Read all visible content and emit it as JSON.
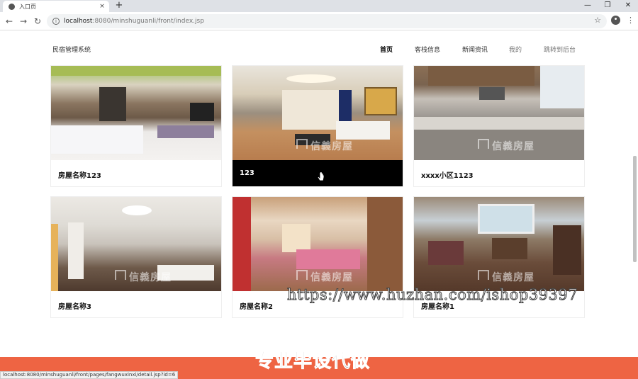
{
  "browser": {
    "tab_title": "入口页",
    "tab_close": "×",
    "new_tab": "+",
    "url_host": "localhost",
    "url_rest": ":8080/minshuguanli/front/index.jsp",
    "back": "←",
    "forward": "→",
    "reload": "↻",
    "info": "i",
    "star": "☆",
    "menu": "⋮",
    "minimize": "—",
    "restore": "❐",
    "close": "✕"
  },
  "header": {
    "site_title": "民宿管理系统",
    "nav": [
      {
        "label": "首页",
        "active": true
      },
      {
        "label": "客栈信息"
      },
      {
        "label": "新闻资讯"
      },
      {
        "label": "我的"
      },
      {
        "label": "跳转到后台"
      }
    ]
  },
  "cards": [
    {
      "title": "房屋名称123",
      "photo": "bedroom-photo"
    },
    {
      "title": "123",
      "photo": "living-room-photo",
      "hovered": true
    },
    {
      "title": "xxxx小区1123",
      "photo": "kitchen-photo"
    },
    {
      "title": "房屋名称3",
      "photo": "empty-room-photo"
    },
    {
      "title": "房屋名称2",
      "photo": "kids-bedroom-photo"
    },
    {
      "title": "房屋名称1",
      "photo": "dining-room-photo"
    }
  ],
  "watermark": "信義房屋",
  "overlay_url": "https://www.huzhan.com/ishop39397",
  "banner_text": "专业毕设代做",
  "status_bar_url": "localhost:8080/minshuguanli/front/pages/fangwuxinxi/detail.jsp?id=6",
  "colors": {
    "banner": "#ee6443",
    "hover_card": "#000000"
  }
}
